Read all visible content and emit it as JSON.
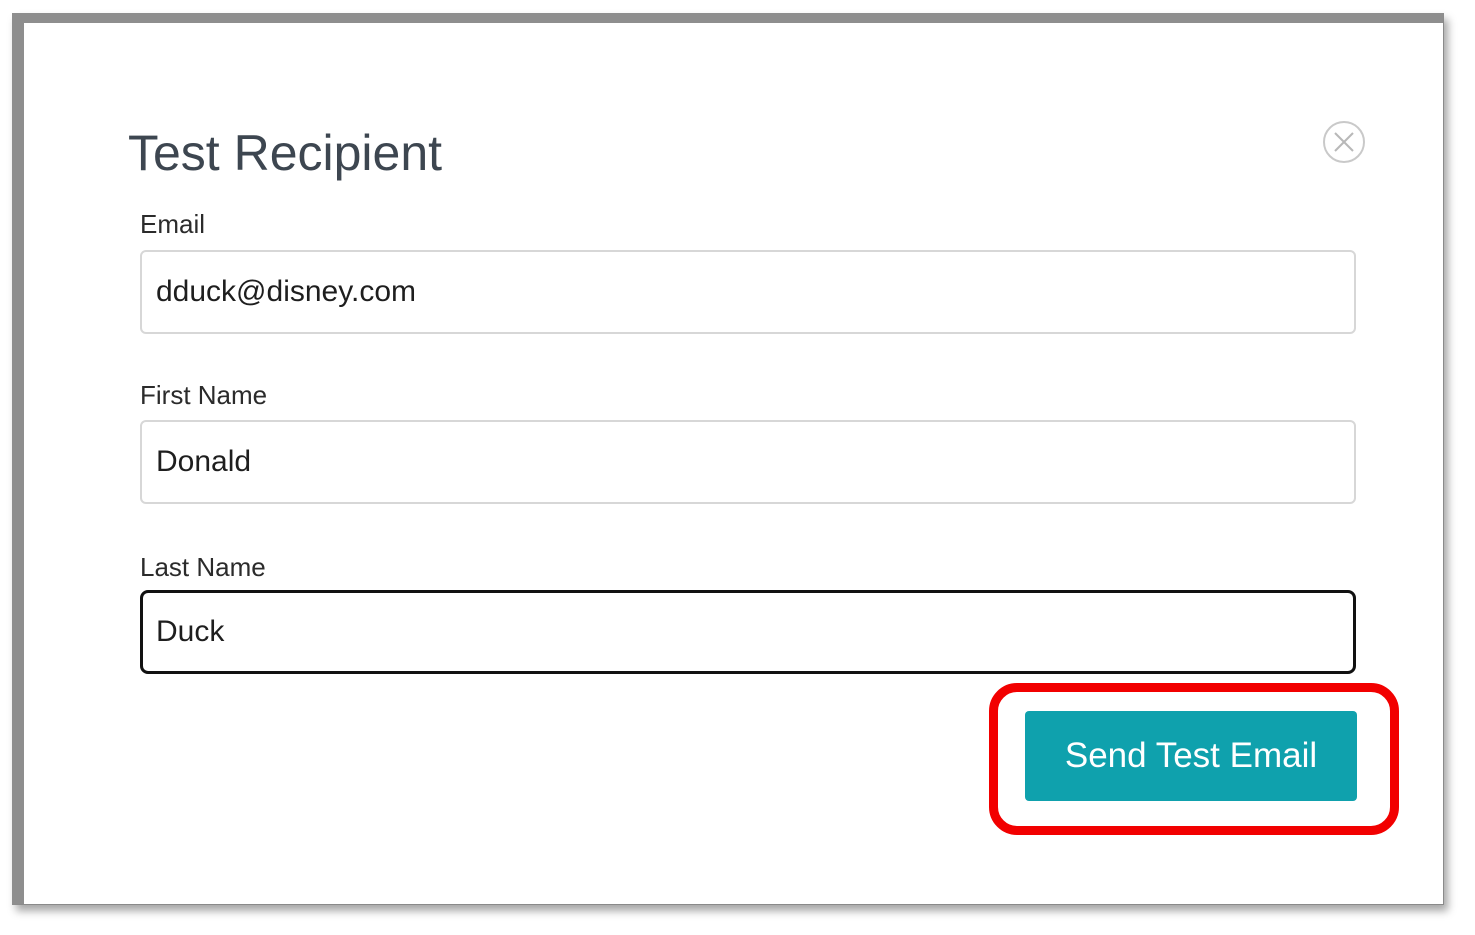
{
  "dialog": {
    "title": "Test Recipient",
    "close_icon": "close-circle-icon"
  },
  "form": {
    "email": {
      "label": "Email",
      "value": "dduck@disney.com"
    },
    "first_name": {
      "label": "First Name",
      "value": "Donald"
    },
    "last_name": {
      "label": "Last Name",
      "value": "Duck"
    }
  },
  "actions": {
    "send_label": "Send Test Email"
  },
  "colors": {
    "accent": "#0fa1ad",
    "highlight": "#f20000",
    "title_text": "#3d4650",
    "focus_border": "#111111"
  }
}
